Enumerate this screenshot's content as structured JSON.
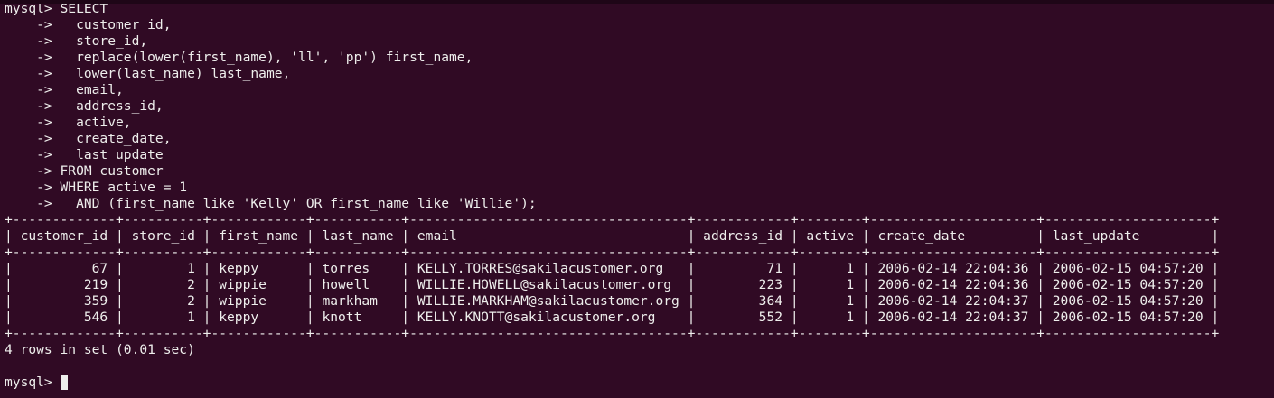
{
  "terminal": {
    "background": "#300a24",
    "foreground": "#eeeeec",
    "lines": [
      "mysql> SELECT",
      "    ->   customer_id,",
      "    ->   store_id,",
      "    ->   replace(lower(first_name), 'll', 'pp') first_name,",
      "    ->   lower(last_name) last_name,",
      "    ->   email,",
      "    ->   address_id,",
      "    ->   active,",
      "    ->   create_date,",
      "    ->   last_update",
      "    -> FROM customer",
      "    -> WHERE active = 1",
      "    ->   AND (first_name like 'Kelly' OR first_name like 'Willie');",
      "+-------------+----------+------------+-----------+-----------------------------------+------------+--------+---------------------+---------------------+",
      "| customer_id | store_id | first_name | last_name | email                             | address_id | active | create_date         | last_update         |",
      "+-------------+----------+------------+-----------+-----------------------------------+------------+--------+---------------------+---------------------+",
      "|          67 |        1 | keppy      | torres    | KELLY.TORRES@sakilacustomer.org   |         71 |      1 | 2006-02-14 22:04:36 | 2006-02-15 04:57:20 |",
      "|         219 |        2 | wippie     | howell    | WILLIE.HOWELL@sakilacustomer.org  |        223 |      1 | 2006-02-14 22:04:36 | 2006-02-15 04:57:20 |",
      "|         359 |        2 | wippie     | markham   | WILLIE.MARKHAM@sakilacustomer.org |        364 |      1 | 2006-02-14 22:04:37 | 2006-02-15 04:57:20 |",
      "|         546 |        1 | keppy      | knott     | KELLY.KNOTT@sakilacustomer.org    |        552 |      1 | 2006-02-14 22:04:37 | 2006-02-15 04:57:20 |",
      "+-------------+----------+------------+-----------+-----------------------------------+------------+--------+---------------------+---------------------+",
      "4 rows in set (0.01 sec)",
      ""
    ],
    "prompt": "mysql> "
  }
}
